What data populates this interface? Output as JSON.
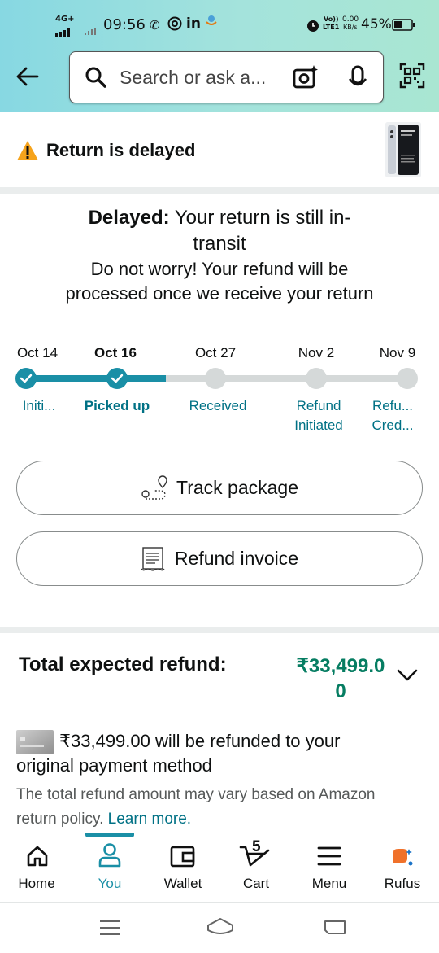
{
  "status_bar": {
    "network": "4G+",
    "time": "09:56",
    "volte_top": "Vo))",
    "volte_bottom": "LTE1",
    "speed_top": "0.00",
    "speed_bottom": "KB/s",
    "battery": "45%"
  },
  "search": {
    "placeholder": "Search or ask a..."
  },
  "banner": {
    "title": "Return is delayed"
  },
  "message": {
    "bold": "Delayed:",
    "line1_rest": " Your return is still in-",
    "line2": "transit",
    "line3": "Do not worry! Your refund will be",
    "line4": "processed once we receive your return"
  },
  "timeline": {
    "steps": [
      {
        "date": "Oct 14",
        "label": "Initi...",
        "label2": "",
        "done": true
      },
      {
        "date": "Oct 16",
        "label": "Picked up",
        "label2": "",
        "done": true
      },
      {
        "date": "Oct 27",
        "label": "Received",
        "label2": "",
        "done": false
      },
      {
        "date": "Nov 2",
        "label": "Refund",
        "label2": "Initiated",
        "done": false
      },
      {
        "date": "Nov 9",
        "label": "Refu...",
        "label2": "Cred...",
        "done": false
      }
    ]
  },
  "buttons": {
    "track": "Track package",
    "invoice": "Refund invoice"
  },
  "refund": {
    "label": "Total expected refund:",
    "amount_line1": "₹33,499.0",
    "amount_line2": "0",
    "method_line1": "₹33,499.00 will be refunded to your",
    "method_line2": "original payment method",
    "note_line1": "The total refund amount may vary based on Amazon",
    "note_line2": "return policy. ",
    "learn_more": "Learn more."
  },
  "bottom_nav": {
    "home": "Home",
    "you": "You",
    "wallet": "Wallet",
    "cart": "Cart",
    "cart_count": "5",
    "menu": "Menu",
    "rufus": "Rufus"
  },
  "colors": {
    "accent_teal": "#1a8fa6",
    "refund_green": "#067d62",
    "link": "#007185"
  }
}
